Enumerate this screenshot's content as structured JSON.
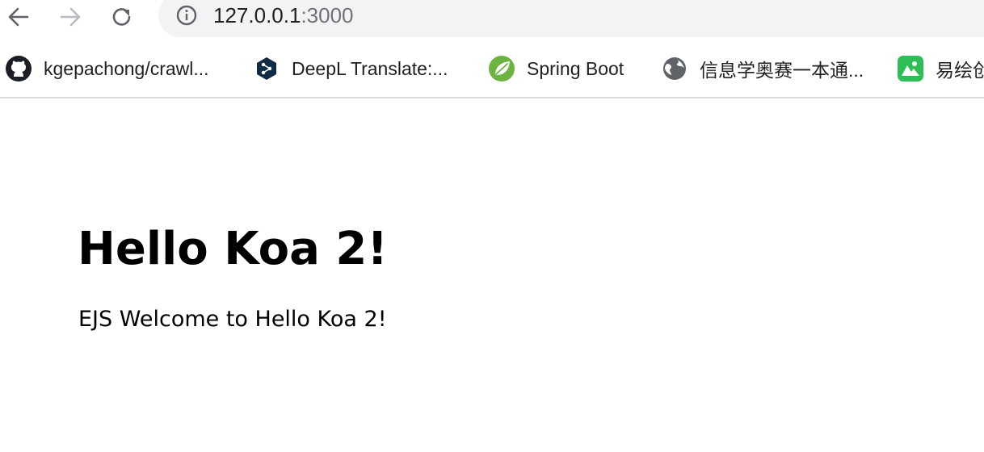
{
  "toolbar": {
    "back_icon": "arrow-left-icon",
    "forward_icon": "arrow-right-icon",
    "reload_icon": "reload-icon",
    "address": {
      "host": "127.0.0.1",
      "port": ":3000",
      "security_icon": "info-circle-icon"
    }
  },
  "bookmarks": [
    {
      "label": "kgepachong/crawl...",
      "icon": "github-icon"
    },
    {
      "label": "DeepL Translate:...",
      "icon": "deepl-icon"
    },
    {
      "label": "Spring Boot",
      "icon": "spring-icon"
    },
    {
      "label": "信息学奥赛一本通...",
      "icon": "globe-icon"
    },
    {
      "label": "易绘创",
      "icon": "yihuichuang-icon"
    }
  ],
  "page": {
    "heading": "Hello Koa 2!",
    "welcome": "EJS Welcome to Hello Koa 2!"
  },
  "colors": {
    "omnibox_bg": "#f1f3f4",
    "spring_green": "#6db33f",
    "deepl_navy": "#0f2b46",
    "yihuichuang_green": "#2fbe55"
  }
}
